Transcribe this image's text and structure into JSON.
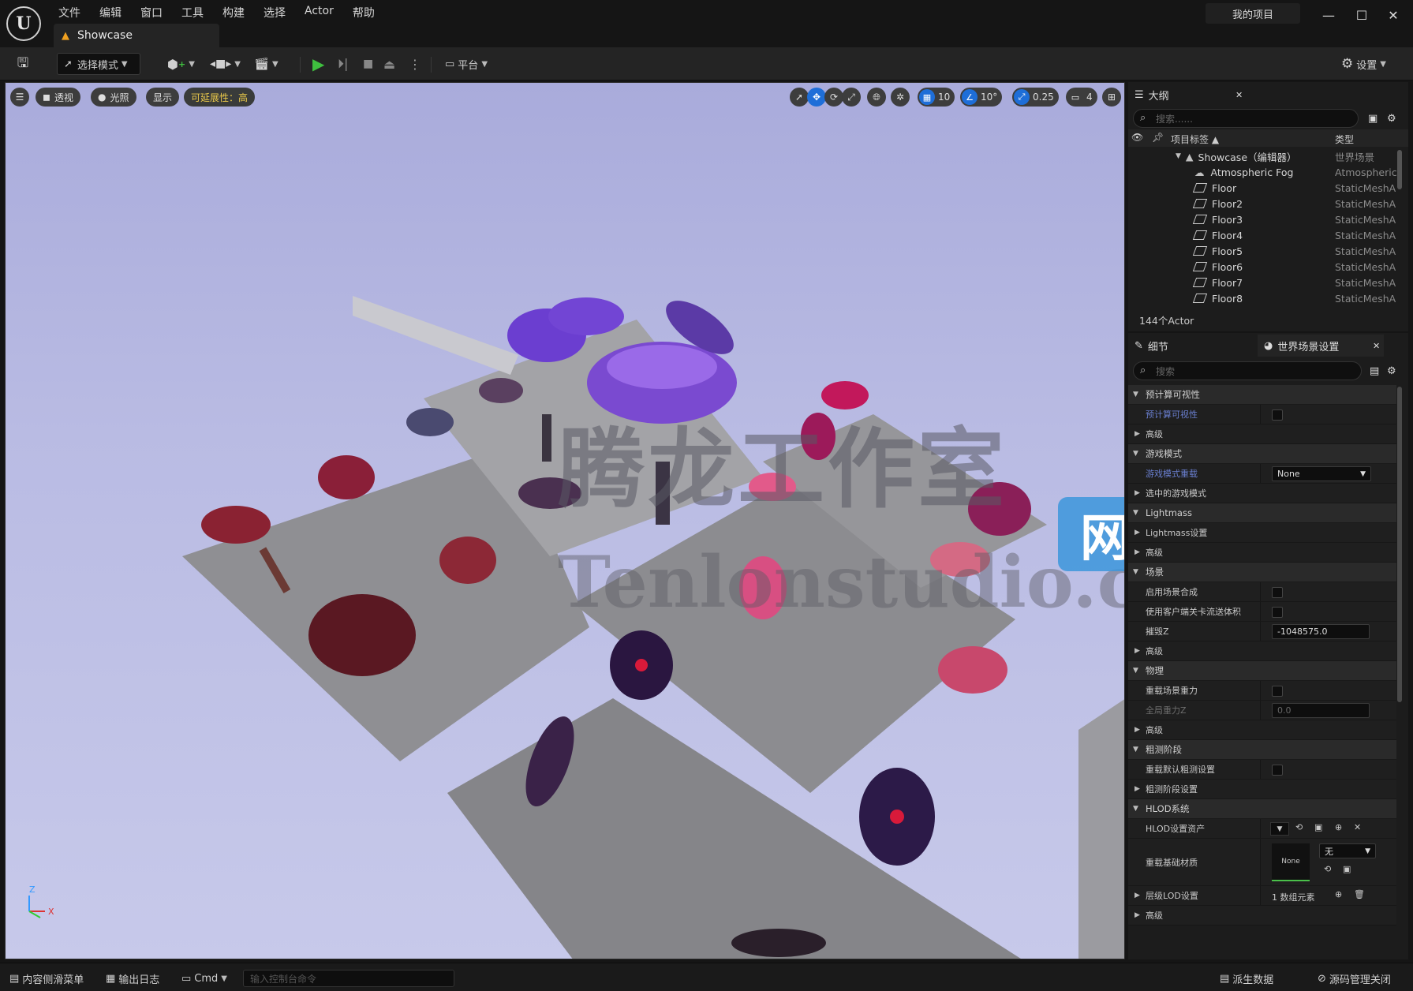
{
  "app": {
    "logo": "U",
    "menu": [
      "文件",
      "编辑",
      "窗口",
      "工具",
      "构建",
      "选择",
      "Actor",
      "帮助"
    ],
    "document_tab": "Showcase",
    "project_name": "我的项目",
    "window_controls": [
      "minimize-icon",
      "maximize-icon",
      "close-icon"
    ]
  },
  "toolbar": {
    "select_mode": "选择模式",
    "platform": "平台",
    "settings": "设置"
  },
  "viewport": {
    "perspective": "透视",
    "lit": "光照",
    "show": "显示",
    "scalability": "可延展性：高",
    "grid_snap": "10",
    "rotation_snap": "10°",
    "scale_snap": "0.25",
    "camera_speed": "4",
    "watermark_cn": "腾龙工作室",
    "watermark_en": "Tenlonstudio.com",
    "watermark_site": "网站",
    "axis_x": "X",
    "axis_z": "Z"
  },
  "outliner": {
    "tab_title": "大纲",
    "search_placeholder": "搜索......",
    "col_label": "项目标签 ▲",
    "col_type": "类型",
    "root": {
      "name": "Showcase（编辑器）",
      "type": "世界场景"
    },
    "rows": [
      {
        "name": "Atmospheric Fog",
        "type": "AtmosphericF"
      },
      {
        "name": "Floor",
        "type": "StaticMeshA"
      },
      {
        "name": "Floor2",
        "type": "StaticMeshA"
      },
      {
        "name": "Floor3",
        "type": "StaticMeshA"
      },
      {
        "name": "Floor4",
        "type": "StaticMeshA"
      },
      {
        "name": "Floor5",
        "type": "StaticMeshA"
      },
      {
        "name": "Floor6",
        "type": "StaticMeshA"
      },
      {
        "name": "Floor7",
        "type": "StaticMeshA"
      },
      {
        "name": "Floor8",
        "type": "StaticMeshA"
      }
    ],
    "actor_count": "144个Actor"
  },
  "details": {
    "tab_details": "细节",
    "tab_world": "世界场景设置",
    "search_placeholder": "搜索",
    "s_precomputed": "预计算可视性",
    "p_precomputed": "预计算可视性",
    "s_advanced1": "高级",
    "s_gamemode": "游戏模式",
    "p_gamemode_override": "游戏模式重载",
    "v_gamemode_override": "None",
    "p_selected_gamemode": "选中的游戏模式",
    "s_lightmass": "Lightmass",
    "p_lightmass_settings": "Lightmass设置",
    "p_advanced2": "高级",
    "s_world": "场景",
    "p_world_composition": "启用场景合成",
    "p_client_streaming": "使用客户端关卡流送体积",
    "p_kill_z": "摧毁Z",
    "v_kill_z": "-1048575.0",
    "p_advanced3": "高级",
    "s_physics": "物理",
    "p_override_gravity": "重载场景重力",
    "p_global_gravity": "全局重力Z",
    "v_global_gravity": "0.0",
    "p_advanced4": "高级",
    "s_broadphase": "粗测阶段",
    "p_override_broadphase": "重载默认粗测设置",
    "p_broadphase_settings": "粗测阶段设置",
    "s_hlod": "HLOD系统",
    "p_hlod_asset": "HLOD设置资产",
    "p_base_material": "重载基础材质",
    "v_base_material_thumb": "None",
    "v_base_material": "无",
    "p_hierarchical_lod": "层级LOD设置",
    "v_hierarchical_lod": "1 数组元素",
    "p_advanced5": "高级"
  },
  "statusbar": {
    "content_drawer": "内容侧滑菜单",
    "output_log": "输出日志",
    "cmd": "Cmd",
    "console_placeholder": "输入控制台命令",
    "derived_data": "派生数据",
    "source_control": "源码管理关闭"
  },
  "colors": {
    "accent_blue": "#1e6ed8",
    "play_green": "#3fbf3f",
    "scalability_yellow": "#e9c84a",
    "warning_orange": "#f0a020"
  }
}
